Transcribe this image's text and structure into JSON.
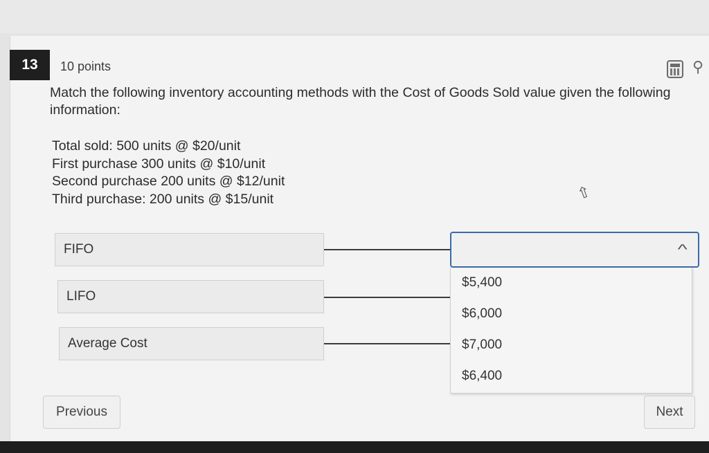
{
  "question": {
    "number": "13",
    "points": "10 points",
    "prompt": "Match the following inventory accounting methods with the Cost of Goods Sold value given the following information:",
    "info_lines": [
      "Total sold: 500 units @ $20/unit",
      "First purchase 300 units @ $10/unit",
      "Second purchase 200 units @ $12/unit",
      "Third purchase: 200 units @ $15/unit"
    ]
  },
  "toolbar": {
    "calculator_icon": "calculator-icon",
    "pin_icon": "pin-icon"
  },
  "matching": {
    "terms": [
      "FIFO",
      "LIFO",
      "Average Cost"
    ],
    "dropdown": {
      "selected": "",
      "options": [
        "$5,400",
        "$6,000",
        "$7,000",
        "$6,400"
      ]
    }
  },
  "navigation": {
    "previous_label": "Previous",
    "next_label": "Next"
  },
  "colors": {
    "dropdown_border": "#3a6aa8",
    "question_badge": "#1f1f1f"
  }
}
